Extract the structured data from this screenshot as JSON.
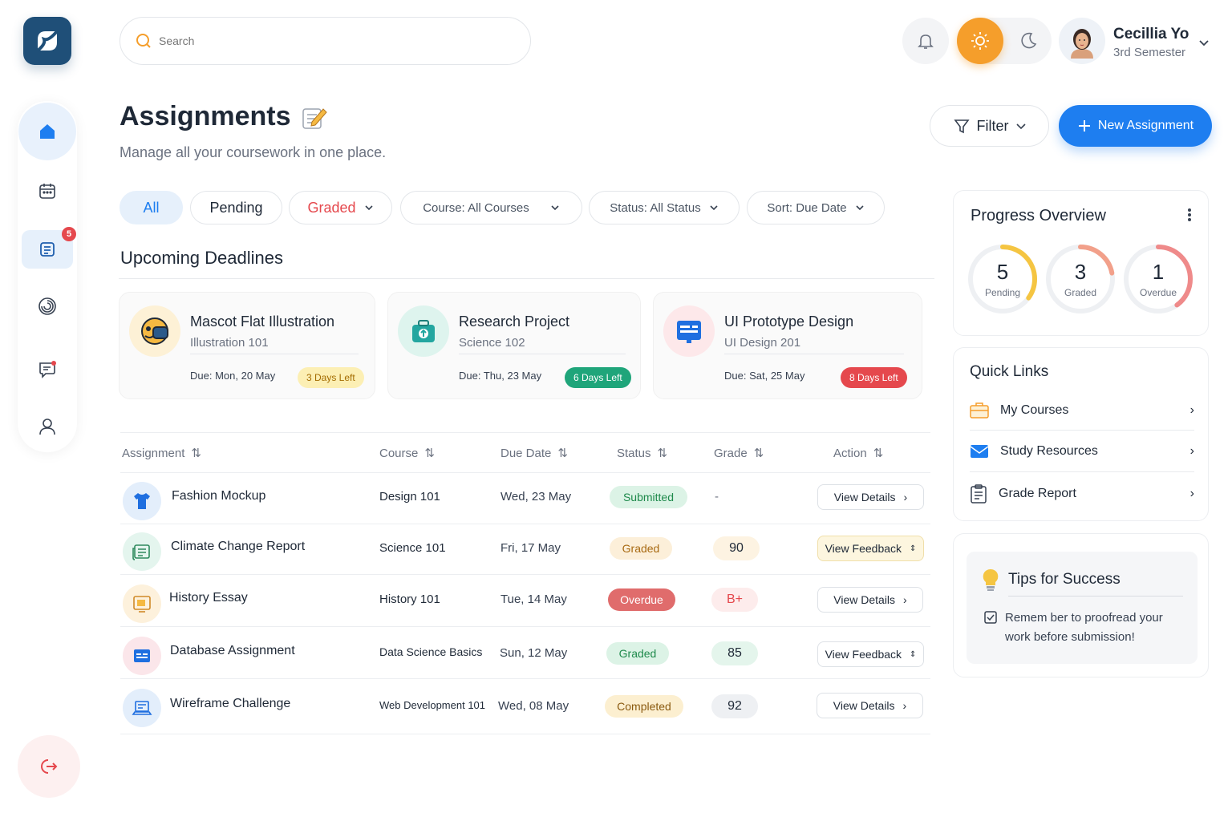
{
  "search": {
    "placeholder": "Search"
  },
  "user": {
    "name": "Cecillia Yo",
    "semester": "3rd Semester"
  },
  "page": {
    "title": "Assignments",
    "subtitle": "Manage all your coursework in one place."
  },
  "actions": {
    "filter": "Filter",
    "new_assignment": "New Assignment"
  },
  "sidebar": {
    "badge_count": "5"
  },
  "filters": {
    "all": "All",
    "pending": "Pending",
    "graded": "Graded",
    "course_label": "Course:",
    "course_value": "All Courses",
    "status_label": "Status:",
    "status_value": "All Status",
    "sort_label": "Sort:",
    "sort_value": "Due Date"
  },
  "deadlines": {
    "title": "Upcoming Deadlines",
    "cards": [
      {
        "title": "Mascot Flat Illustration",
        "course": "Illustration 101",
        "due_label": "Due:",
        "due": "Mon, 20 May",
        "left": "3 Days Left",
        "color": "#f7e28f"
      },
      {
        "title": "Research Project",
        "course": "Science 102",
        "due_label": "Due:",
        "due": "Thu, 23 May",
        "left": "6 Days Left",
        "color": "#1fa57a"
      },
      {
        "title": "UI Prototype Design",
        "course": "UI Design 201",
        "due_label": "Due:",
        "due": "Sat, 25 May",
        "left": "8 Days Left",
        "color": "#e5484d"
      }
    ]
  },
  "table": {
    "headers": [
      "Assignment",
      "Course",
      "Due Date",
      "Status",
      "Grade",
      "Action"
    ],
    "rows": [
      {
        "name": "Fashion Mockup",
        "course": "Design 101",
        "due": "Wed, 23 May",
        "status": "Submitted",
        "grade": "-",
        "action": "View Details"
      },
      {
        "name": "Climate Change Report",
        "course": "Science 101",
        "due": "Fri, 17 May",
        "status": "Graded",
        "grade": "90",
        "action": "View Feedback"
      },
      {
        "name": "History Essay",
        "course": "History 101",
        "due": "Tue, 14 May",
        "status": "Overdue",
        "grade": "B+",
        "action": "View Details"
      },
      {
        "name": "Database Assignment",
        "course": "Data Science Basics",
        "due": "Sun, 12 May",
        "status": "Graded",
        "grade": "85",
        "action": "View Feedback"
      },
      {
        "name": "Wireframe Challenge",
        "course": "Web Development 101",
        "due": "Wed, 08 May",
        "status": "Completed",
        "grade": "92",
        "action": "View Details"
      }
    ]
  },
  "progress": {
    "title": "Progress Overview",
    "items": [
      {
        "value": "5",
        "label": "Pending",
        "color": "#f5c542",
        "fraction": 0.35
      },
      {
        "value": "3",
        "label": "Graded",
        "color": "#f2a08a",
        "fraction": 0.22
      },
      {
        "value": "1",
        "label": "Overdue",
        "color": "#ef8a8a",
        "fraction": 0.4
      }
    ]
  },
  "quick_links": {
    "title": "Quick Links",
    "items": [
      "My Courses",
      "Study Resources",
      "Grade Report"
    ]
  },
  "tips": {
    "title": "Tips for Success",
    "text": "Remem ber to proofread your work before submission!"
  },
  "colors": {
    "accent": "#1e7ef0",
    "sun": "#f59e2b",
    "brand": "#1f4f78"
  }
}
